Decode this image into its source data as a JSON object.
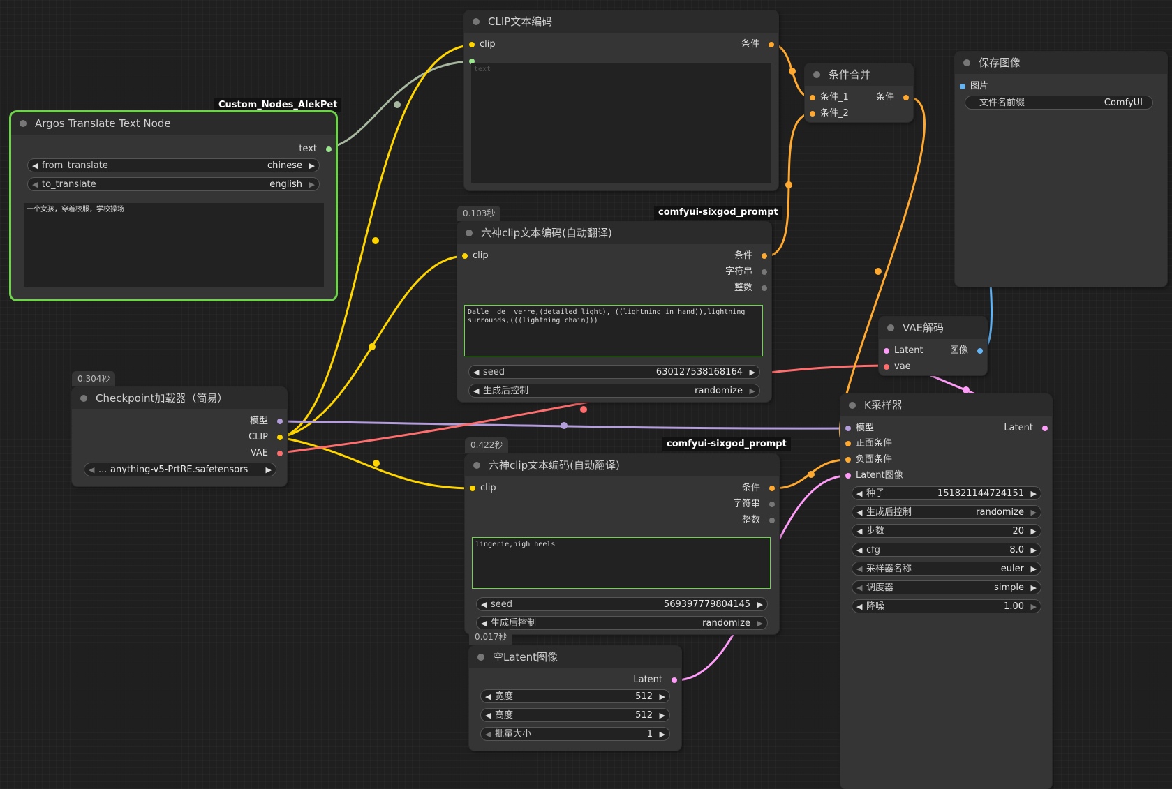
{
  "nodes": {
    "clip_text": {
      "title": "CLIP文本编码",
      "input_clip": "clip",
      "output": "条件",
      "text_placeholder": "text"
    },
    "cond_combine": {
      "title": "条件合并",
      "input1": "条件_1",
      "input2": "条件_2",
      "output": "条件"
    },
    "save_image": {
      "title": "保存图像",
      "input": "图片",
      "prefix_label": "文件名前缀",
      "prefix_value": "ComfyUI"
    },
    "argos": {
      "tag": "Custom_Nodes_AlekPet",
      "title": "Argos Translate Text Node",
      "output": "text",
      "from_label": "from_translate",
      "from_value": "chinese",
      "to_label": "to_translate",
      "to_value": "english",
      "text": "一个女孩，穿着校服，学校操场"
    },
    "sixgod1": {
      "time": "0.103秒",
      "tag": "comfyui-sixgod_prompt",
      "title": "六神clip文本编码(自动翻译)",
      "input_clip": "clip",
      "out1": "条件",
      "out2": "字符串",
      "out3": "整数",
      "text": "Dalle  de  verre,(detailed light), ((lightning in hand)),lightning\nsurrounds,(((lightning chain)))",
      "seed_label": "seed",
      "seed_value": "630127538168164",
      "ctrl_label": "生成后控制",
      "ctrl_value": "randomize"
    },
    "vae_decode": {
      "title": "VAE解码",
      "in1": "Latent",
      "in2": "vae",
      "output": "图像"
    },
    "checkpoint": {
      "time": "0.304秒",
      "title": "Checkpoint加载器（简易）",
      "out1": "模型",
      "out2": "CLIP",
      "out3": "VAE",
      "ckpt_prefix": "...",
      "ckpt_value": "anything-v5-PrtRE.safetensors"
    },
    "ksampler": {
      "title": "K采样器",
      "in1": "模型",
      "in2": "正面条件",
      "in3": "负面条件",
      "in4": "Latent图像",
      "output": "Latent",
      "widgets": [
        {
          "label": "种子",
          "value": "151821144724151"
        },
        {
          "label": "生成后控制",
          "value": "randomize"
        },
        {
          "label": "步数",
          "value": "20"
        },
        {
          "label": "cfg",
          "value": "8.0"
        },
        {
          "label": "采样器名称",
          "value": "euler"
        },
        {
          "label": "调度器",
          "value": "simple"
        },
        {
          "label": "降噪",
          "value": "1.00"
        }
      ]
    },
    "sixgod2": {
      "time": "0.422秒",
      "tag": "comfyui-sixgod_prompt",
      "title": "六神clip文本编码(自动翻译)",
      "input_clip": "clip",
      "out1": "条件",
      "out2": "字符串",
      "out3": "整数",
      "text": "lingerie,high heels",
      "seed_label": "seed",
      "seed_value": "569397779804145",
      "ctrl_label": "生成后控制",
      "ctrl_value": "randomize"
    },
    "empty_latent": {
      "time": "0.017秒",
      "title": "空Latent图像",
      "output": "Latent",
      "widgets": [
        {
          "label": "宽度",
          "value": "512"
        },
        {
          "label": "高度",
          "value": "512"
        },
        {
          "label": "批量大小",
          "value": "1"
        }
      ]
    }
  },
  "colors": {
    "clip": "#ffd500",
    "conditioning": "#ffa931",
    "model": "#b39ddb",
    "vae": "#ff6e6e",
    "latent": "#ff9cf9",
    "image": "#64b5f6",
    "string": "#a8b8a0"
  }
}
